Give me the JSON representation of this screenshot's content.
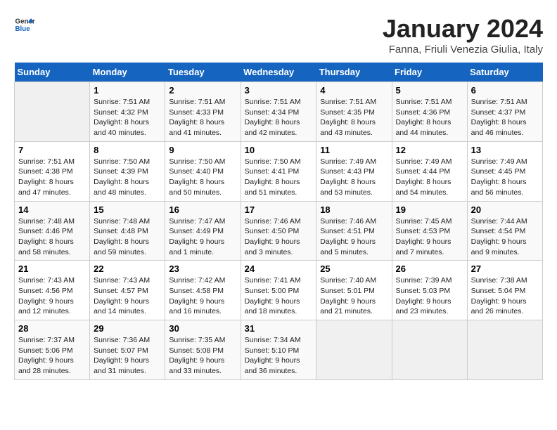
{
  "header": {
    "logo_general": "General",
    "logo_blue": "Blue",
    "month": "January 2024",
    "location": "Fanna, Friuli Venezia Giulia, Italy"
  },
  "weekdays": [
    "Sunday",
    "Monday",
    "Tuesday",
    "Wednesday",
    "Thursday",
    "Friday",
    "Saturday"
  ],
  "weeks": [
    [
      {
        "day": "",
        "info": ""
      },
      {
        "day": "1",
        "info": "Sunrise: 7:51 AM\nSunset: 4:32 PM\nDaylight: 8 hours\nand 40 minutes."
      },
      {
        "day": "2",
        "info": "Sunrise: 7:51 AM\nSunset: 4:33 PM\nDaylight: 8 hours\nand 41 minutes."
      },
      {
        "day": "3",
        "info": "Sunrise: 7:51 AM\nSunset: 4:34 PM\nDaylight: 8 hours\nand 42 minutes."
      },
      {
        "day": "4",
        "info": "Sunrise: 7:51 AM\nSunset: 4:35 PM\nDaylight: 8 hours\nand 43 minutes."
      },
      {
        "day": "5",
        "info": "Sunrise: 7:51 AM\nSunset: 4:36 PM\nDaylight: 8 hours\nand 44 minutes."
      },
      {
        "day": "6",
        "info": "Sunrise: 7:51 AM\nSunset: 4:37 PM\nDaylight: 8 hours\nand 46 minutes."
      }
    ],
    [
      {
        "day": "7",
        "info": "Sunrise: 7:51 AM\nSunset: 4:38 PM\nDaylight: 8 hours\nand 47 minutes."
      },
      {
        "day": "8",
        "info": "Sunrise: 7:50 AM\nSunset: 4:39 PM\nDaylight: 8 hours\nand 48 minutes."
      },
      {
        "day": "9",
        "info": "Sunrise: 7:50 AM\nSunset: 4:40 PM\nDaylight: 8 hours\nand 50 minutes."
      },
      {
        "day": "10",
        "info": "Sunrise: 7:50 AM\nSunset: 4:41 PM\nDaylight: 8 hours\nand 51 minutes."
      },
      {
        "day": "11",
        "info": "Sunrise: 7:49 AM\nSunset: 4:43 PM\nDaylight: 8 hours\nand 53 minutes."
      },
      {
        "day": "12",
        "info": "Sunrise: 7:49 AM\nSunset: 4:44 PM\nDaylight: 8 hours\nand 54 minutes."
      },
      {
        "day": "13",
        "info": "Sunrise: 7:49 AM\nSunset: 4:45 PM\nDaylight: 8 hours\nand 56 minutes."
      }
    ],
    [
      {
        "day": "14",
        "info": "Sunrise: 7:48 AM\nSunset: 4:46 PM\nDaylight: 8 hours\nand 58 minutes."
      },
      {
        "day": "15",
        "info": "Sunrise: 7:48 AM\nSunset: 4:48 PM\nDaylight: 8 hours\nand 59 minutes."
      },
      {
        "day": "16",
        "info": "Sunrise: 7:47 AM\nSunset: 4:49 PM\nDaylight: 9 hours\nand 1 minute."
      },
      {
        "day": "17",
        "info": "Sunrise: 7:46 AM\nSunset: 4:50 PM\nDaylight: 9 hours\nand 3 minutes."
      },
      {
        "day": "18",
        "info": "Sunrise: 7:46 AM\nSunset: 4:51 PM\nDaylight: 9 hours\nand 5 minutes."
      },
      {
        "day": "19",
        "info": "Sunrise: 7:45 AM\nSunset: 4:53 PM\nDaylight: 9 hours\nand 7 minutes."
      },
      {
        "day": "20",
        "info": "Sunrise: 7:44 AM\nSunset: 4:54 PM\nDaylight: 9 hours\nand 9 minutes."
      }
    ],
    [
      {
        "day": "21",
        "info": "Sunrise: 7:43 AM\nSunset: 4:56 PM\nDaylight: 9 hours\nand 12 minutes."
      },
      {
        "day": "22",
        "info": "Sunrise: 7:43 AM\nSunset: 4:57 PM\nDaylight: 9 hours\nand 14 minutes."
      },
      {
        "day": "23",
        "info": "Sunrise: 7:42 AM\nSunset: 4:58 PM\nDaylight: 9 hours\nand 16 minutes."
      },
      {
        "day": "24",
        "info": "Sunrise: 7:41 AM\nSunset: 5:00 PM\nDaylight: 9 hours\nand 18 minutes."
      },
      {
        "day": "25",
        "info": "Sunrise: 7:40 AM\nSunset: 5:01 PM\nDaylight: 9 hours\nand 21 minutes."
      },
      {
        "day": "26",
        "info": "Sunrise: 7:39 AM\nSunset: 5:03 PM\nDaylight: 9 hours\nand 23 minutes."
      },
      {
        "day": "27",
        "info": "Sunrise: 7:38 AM\nSunset: 5:04 PM\nDaylight: 9 hours\nand 26 minutes."
      }
    ],
    [
      {
        "day": "28",
        "info": "Sunrise: 7:37 AM\nSunset: 5:06 PM\nDaylight: 9 hours\nand 28 minutes."
      },
      {
        "day": "29",
        "info": "Sunrise: 7:36 AM\nSunset: 5:07 PM\nDaylight: 9 hours\nand 31 minutes."
      },
      {
        "day": "30",
        "info": "Sunrise: 7:35 AM\nSunset: 5:08 PM\nDaylight: 9 hours\nand 33 minutes."
      },
      {
        "day": "31",
        "info": "Sunrise: 7:34 AM\nSunset: 5:10 PM\nDaylight: 9 hours\nand 36 minutes."
      },
      {
        "day": "",
        "info": ""
      },
      {
        "day": "",
        "info": ""
      },
      {
        "day": "",
        "info": ""
      }
    ]
  ]
}
